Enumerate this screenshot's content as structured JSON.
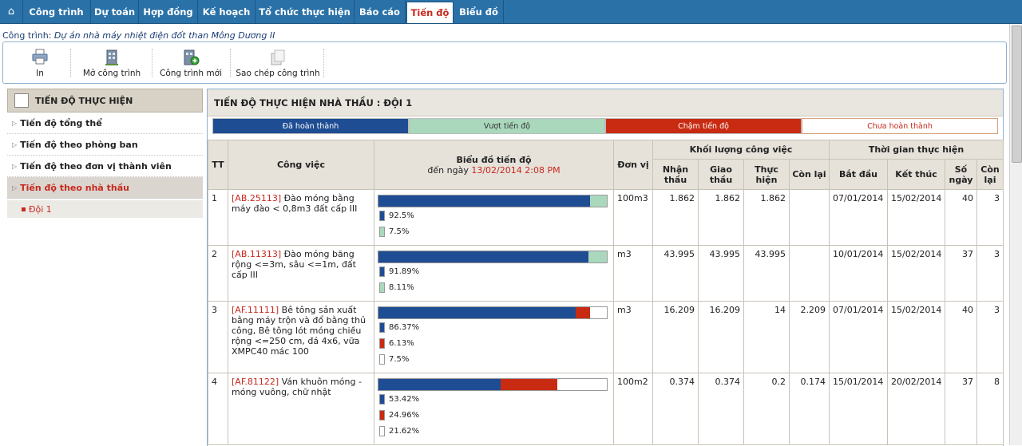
{
  "colors": {
    "done": "#1f4d94",
    "over": "#a9d8bd",
    "late": "#c82b12",
    "notdone": "#ffffff",
    "accent": "#c8281e",
    "nav": "#2a71a8"
  },
  "nav": {
    "home_icon": "home-icon",
    "tabs": [
      {
        "label": "Công trình"
      },
      {
        "label": "Dự toán"
      },
      {
        "label": "Hợp đồng"
      },
      {
        "label": "Kế hoạch"
      },
      {
        "label": "Tổ chức thực hiện"
      },
      {
        "label": "Báo cáo"
      },
      {
        "label": "Tiến độ",
        "active": true
      },
      {
        "label": "Biểu đồ"
      }
    ]
  },
  "breadcrumb": {
    "label": "Công trình:",
    "value": "Dự án nhà máy nhiệt điện đốt than Mông Dương II"
  },
  "toolbar": {
    "print": "In",
    "open": "Mở công trình",
    "new": "Công trình mới",
    "copy": "Sao chép công trình"
  },
  "sidebar": {
    "header": "TIẾN ĐỘ THỰC HIỆN",
    "items": [
      {
        "label": "Tiến độ tổng thể"
      },
      {
        "label": "Tiến độ theo phòng ban"
      },
      {
        "label": "Tiến độ theo đơn vị thành viên"
      },
      {
        "label": "Tiến độ theo nhà thầu"
      }
    ],
    "sub": "Đội 1"
  },
  "main": {
    "title": "TIẾN ĐỘ THỰC HIỆN NHÀ THẦU : ĐỘI 1",
    "legend": {
      "done": "Đã hoàn thành",
      "over": "Vượt tiến độ",
      "late": "Chậm tiến độ",
      "notdone": "Chưa hoàn thành"
    },
    "headers": {
      "tt": "TT",
      "task": "Công việc",
      "chart_line1": "Biểu đồ tiến độ",
      "chart_line2": "đến ngày",
      "chart_date": "13/02/2014 2:08 PM",
      "unit": "Đơn vị",
      "volume": "Khối lượng công việc",
      "time": "Thời gian thực hiện",
      "received": "Nhận thầu",
      "assigned": "Giao thầu",
      "done": "Thực hiện",
      "remain": "Còn lại",
      "start": "Bắt đầu",
      "end": "Kết thúc",
      "days": "Số ngày",
      "days_left": "Còn lại"
    },
    "rows": [
      {
        "tt": "1",
        "code": "[AB.25113]",
        "name": " Đào móng bằng máy đào < 0,8m3 đất cấp III",
        "unit": "100m3",
        "received": "1.862",
        "assigned": "1.862",
        "done": "1.862",
        "remain": "",
        "start": "07/01/2014",
        "end": "15/02/2014",
        "days": "40",
        "days_left": "3",
        "progress": [
          {
            "kind": "done",
            "pct": 92.5,
            "label": "92.5%"
          },
          {
            "kind": "over",
            "pct": 7.5,
            "label": "7.5%"
          }
        ]
      },
      {
        "tt": "2",
        "code": "[AB.11313]",
        "name": " Đào móng băng rộng <=3m, sâu <=1m, đất cấp III",
        "unit": "m3",
        "received": "43.995",
        "assigned": "43.995",
        "done": "43.995",
        "remain": "",
        "start": "10/01/2014",
        "end": "15/02/2014",
        "days": "37",
        "days_left": "3",
        "progress": [
          {
            "kind": "done",
            "pct": 91.89,
            "label": "91.89%"
          },
          {
            "kind": "over",
            "pct": 8.11,
            "label": "8.11%"
          }
        ]
      },
      {
        "tt": "3",
        "code": "[AF.11111]",
        "name": " Bê tông sản xuất bằng máy trộn và đổ bằng thủ công, Bê tông lót móng chiều rộng <=250 cm, đá 4x6, vữa XMPC40 mác 100",
        "unit": "m3",
        "received": "16.209",
        "assigned": "16.209",
        "done": "14",
        "remain": "2.209",
        "start": "07/01/2014",
        "end": "15/02/2014",
        "days": "40",
        "days_left": "3",
        "progress": [
          {
            "kind": "done",
            "pct": 86.37,
            "label": "86.37%"
          },
          {
            "kind": "late",
            "pct": 6.13,
            "label": "6.13%"
          },
          {
            "kind": "notdone",
            "pct": 7.5,
            "label": "7.5%"
          }
        ]
      },
      {
        "tt": "4",
        "code": "[AF.81122]",
        "name": " Ván khuôn móng - móng vuông, chữ nhật",
        "unit": "100m2",
        "received": "0.374",
        "assigned": "0.374",
        "done": "0.2",
        "remain": "0.174",
        "start": "15/01/2014",
        "end": "20/02/2014",
        "days": "37",
        "days_left": "8",
        "progress": [
          {
            "kind": "done",
            "pct": 53.42,
            "label": "53.42%"
          },
          {
            "kind": "late",
            "pct": 24.96,
            "label": "24.96%"
          },
          {
            "kind": "notdone",
            "pct": 21.62,
            "label": "21.62%"
          }
        ]
      }
    ]
  }
}
